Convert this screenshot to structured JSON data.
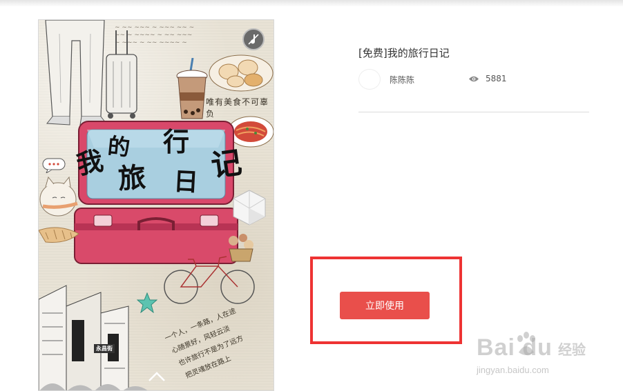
{
  "template": {
    "title": "[免费]我的旅行日记",
    "author": "陈陈陈",
    "views": "5881"
  },
  "poster": {
    "title_chars": [
      "我",
      "的",
      "旅",
      "行",
      "日",
      "记"
    ],
    "food_text": "唯有美食不可辜负",
    "shop_sign": "永昌街"
  },
  "actions": {
    "use_label": "立即使用"
  },
  "watermark": {
    "logo": "Bai du",
    "site_name": "经验",
    "url": "jingyan.baidu.com"
  },
  "colors": {
    "accent": "#e94f4b",
    "highlight": "#ee3333",
    "suitcase": "#d9486a",
    "suitcase_sky": "#a9cfe0"
  }
}
